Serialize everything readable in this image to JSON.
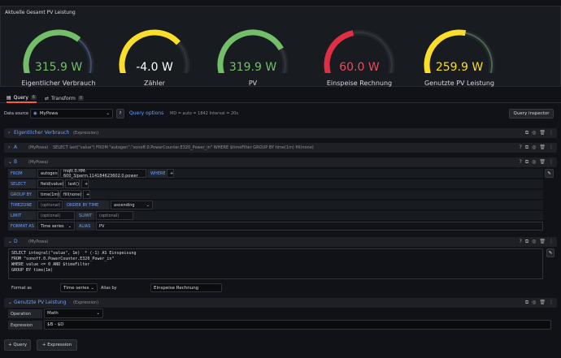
{
  "panel": {
    "title": "Aktuelle Gesamt PV Leistung"
  },
  "gauges": [
    {
      "value": "315.9 W",
      "label": "Eigentlicher Verbrauch",
      "fraction": 0.68,
      "color": "#73bf69",
      "track": "#5b7bd5"
    },
    {
      "value": "-4.0 W",
      "label": "Zähler",
      "fraction": 0.72,
      "color": "#fade2a",
      "track": "#3a3d44"
    },
    {
      "value": "319.9 W",
      "label": "PV",
      "fraction": 0.78,
      "color": "#73bf69",
      "track": "#3a3d44"
    },
    {
      "value": "60.0 W",
      "label": "Einspeise Rechnung",
      "fraction": 0.45,
      "color": "#e02f44",
      "track": "#3a3d44"
    },
    {
      "value": "259.9 W",
      "label": "Genutzte PV Leistung",
      "fraction": 0.55,
      "color": "#fade2a",
      "track": "#73bf69"
    }
  ],
  "value_colors": [
    "#73bf69",
    "#ffffff",
    "#73bf69",
    "#f2495c",
    "#fade2a"
  ],
  "tabs": {
    "query": "Query",
    "query_count": "6",
    "transform": "Transform",
    "transform_count": "0"
  },
  "datasource": {
    "label": "Data source",
    "name": "MyPowa",
    "options": "Query options",
    "options_detail": "MD = auto = 1842   Interval = 20s",
    "inspector": "Query inspector"
  },
  "rows": {
    "verbrauch": {
      "title": "Eigentlicher Verbrauch",
      "sub": "(Expression)"
    },
    "a": {
      "letter": "A",
      "source": "(MyPowa)",
      "query": "SELECT last(\"value\") FROM \"autogen\".\"sonoff.0.PowerCounter.E320_Power_in\" WHERE $timeFilter GROUP BY time(1m) fill(none)"
    },
    "b": {
      "letter": "B",
      "source": "(MyPowa)"
    },
    "d": {
      "letter": "D",
      "source": "(MyPowa)"
    },
    "genutzt": {
      "title": "Genutzte PV Leistung",
      "sub": "(Expression)"
    }
  },
  "builder": {
    "from": "FROM",
    "from_rp": "autogen",
    "from_m": "mqtt.0.HM-600_3/perm.114184623602.0.power",
    "where": "WHERE",
    "plus": "+",
    "select": "SELECT",
    "field": "field(value)",
    "last": "last()",
    "groupby": "GROUP BY",
    "time": "time(1m)",
    "fill": "fill(none)",
    "timezone": "TIMEZONE",
    "tz_ph": "(optional)",
    "orderby": "ORDER BY TIME",
    "order": "ascending",
    "limit": "LIMIT",
    "limit_ph": "(optional)",
    "slimit": "SLIMIT",
    "slimit_ph": "(optional)",
    "format": "FORMAT AS",
    "format_val": "Time series",
    "alias": "ALIAS",
    "alias_val": "PV"
  },
  "raw": {
    "lines": [
      "SELECT integral(\"value\", 1m)  * (-1) AS Einspeisung",
      "FROM \"sonoff.0.PowerCounter.E320_Power_in\"",
      "WHERE value <= 0 AND $timeFilter",
      "GROUP BY time(1m)"
    ],
    "format_label": "Format as",
    "format_val": "Time series",
    "alias_label": "Alias by",
    "alias_val": "Einspeise Rechnung"
  },
  "expr": {
    "op_label": "Operation",
    "op_val": "Math",
    "expr_label": "Expression",
    "expr_val": "$B - $D"
  },
  "footer": {
    "add_query": "Query",
    "add_expr": "Expression"
  }
}
